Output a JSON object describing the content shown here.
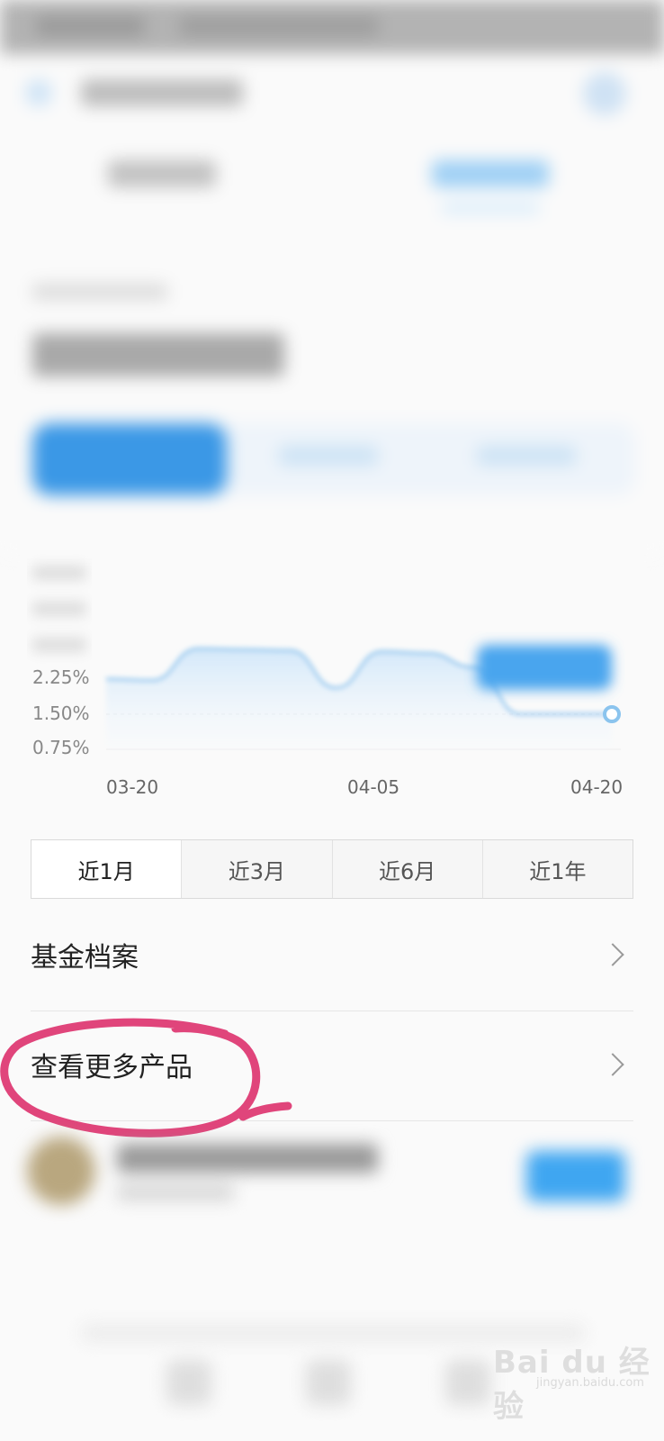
{
  "chart_data": {
    "type": "line",
    "x_ticks": [
      "03-20",
      "04-05",
      "04-20"
    ],
    "y_ticks": [
      "2.25%",
      "1.50%",
      "0.75%"
    ],
    "series": [
      {
        "values": [
          2.25,
          2.22,
          2.9,
          2.88,
          2.86,
          2.06,
          2.84,
          2.8,
          2.5,
          1.5,
          1.5,
          1.5
        ]
      }
    ],
    "accent_color": "#8bc4ee"
  },
  "range_tabs": [
    "近1月",
    "近3月",
    "近6月",
    "近1年"
  ],
  "menu": {
    "fund_profile": "基金档案",
    "more_products": "查看更多产品"
  },
  "annotation_color": "#e0457b",
  "watermark": {
    "main": "Bai du 经验",
    "sub": "jingyan.baidu.com"
  }
}
